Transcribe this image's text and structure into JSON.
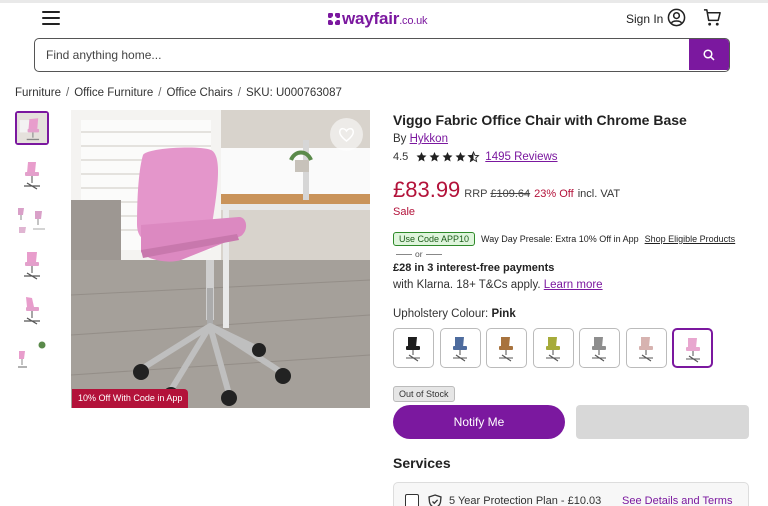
{
  "header": {
    "logo_text": "wayfair",
    "logo_tld": ".co.uk",
    "sign_in": "Sign In",
    "brand_color": "#7b189f"
  },
  "search": {
    "placeholder": "Find anything home...",
    "value": ""
  },
  "breadcrumb": {
    "items": [
      "Furniture",
      "Office Furniture",
      "Office Chairs"
    ],
    "sku": "SKU: U000763087"
  },
  "gallery": {
    "thumbnail_count": 6,
    "selected_thumbnail": 1,
    "promo_badge": "10% Off With Code in App"
  },
  "product": {
    "title": "Viggo Fabric Office Chair with Chrome Base",
    "by_label": "By",
    "brand": "Hykkon",
    "rating": "4.5",
    "rating_value": 4.5,
    "reviews": "1495 Reviews",
    "price": "£83.99",
    "rrp_label": "RRP",
    "rrp_value": "£109.64",
    "discount": "23% Off",
    "vat": "incl. VAT",
    "sale": "Sale"
  },
  "promo": {
    "code": "Use Code APP10",
    "text": "Way Day Presale: Extra 10% Off in App",
    "link": "Shop Eligible Products",
    "or": "or"
  },
  "klarna": {
    "line1": "£28 in 3 interest-free payments",
    "line2": "with Klarna. 18+ T&Cs apply.",
    "link": "Learn more"
  },
  "options": {
    "label": "Upholstery Colour:",
    "selected": "Pink",
    "swatch_colors": [
      "#1d1d1d",
      "#4e6c9e",
      "#a8733e",
      "#a6ab3a",
      "#8e8e8e",
      "#d7b3b0",
      "#e8a6cf"
    ],
    "selected_index": 6
  },
  "stock": {
    "status": "Out of Stock",
    "notify_button": "Notify Me"
  },
  "services": {
    "heading": "Services",
    "protection": "5 Year Protection Plan - £10.03",
    "details_link": "See Details and Terms"
  }
}
